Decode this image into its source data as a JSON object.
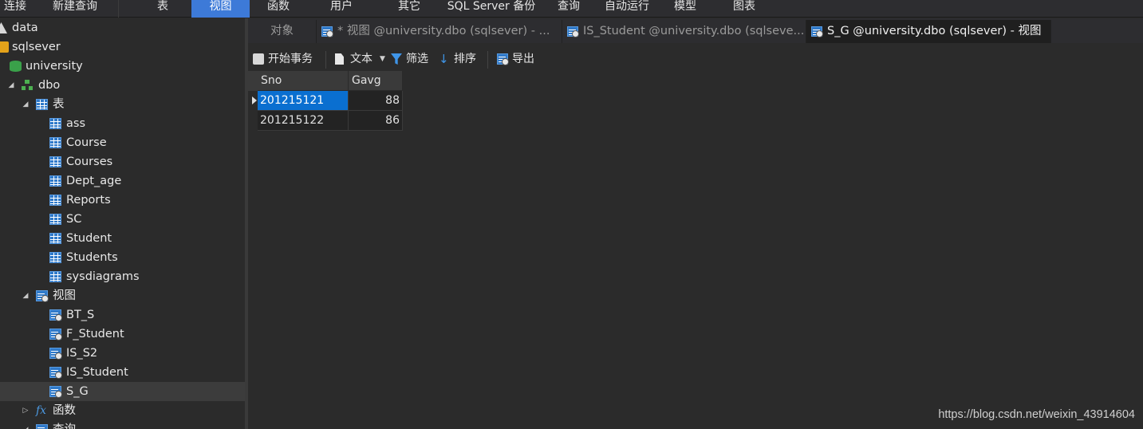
{
  "menu": {
    "items": [
      "连接",
      "新建查询",
      "表",
      "视图",
      "函数",
      "用户",
      "其它",
      "SQL Server 备份",
      "查询",
      "自动运行",
      "模型",
      "图表"
    ],
    "active": "视图"
  },
  "tree": {
    "nodes": [
      {
        "label": "data",
        "icon": "data-icon"
      },
      {
        "label": "sqlsever",
        "icon": "connection-icon"
      },
      {
        "label": "university",
        "icon": "database-icon"
      },
      {
        "label": "dbo",
        "icon": "schema-icon"
      },
      {
        "label": "表",
        "icon": "table-folder-icon"
      },
      {
        "label": "ass",
        "icon": "table-icon"
      },
      {
        "label": "Course",
        "icon": "table-icon"
      },
      {
        "label": "Courses",
        "icon": "table-icon"
      },
      {
        "label": "Dept_age",
        "icon": "table-icon"
      },
      {
        "label": "Reports",
        "icon": "table-icon"
      },
      {
        "label": "SC",
        "icon": "table-icon"
      },
      {
        "label": "Student",
        "icon": "table-icon"
      },
      {
        "label": "Students",
        "icon": "table-icon"
      },
      {
        "label": "sysdiagrams",
        "icon": "table-icon"
      },
      {
        "label": "视图",
        "icon": "view-folder-icon"
      },
      {
        "label": "BT_S",
        "icon": "view-icon"
      },
      {
        "label": "F_Student",
        "icon": "view-icon"
      },
      {
        "label": "IS_S2",
        "icon": "view-icon"
      },
      {
        "label": "IS_Student",
        "icon": "view-icon"
      },
      {
        "label": "S_G",
        "icon": "view-icon",
        "selected": true
      },
      {
        "label": "函数",
        "icon": "function-icon"
      },
      {
        "label": "查询",
        "icon": "query-icon"
      }
    ]
  },
  "tabs": [
    {
      "label": "对象",
      "icon": ""
    },
    {
      "label": "* 视图 @university.dbo (sqlsever) - ...",
      "icon": "view-design-icon"
    },
    {
      "label": "IS_Student @university.dbo (sqlseve...",
      "icon": "view-icon"
    },
    {
      "label": "S_G @university.dbo (sqlsever) - 视图",
      "icon": "view-icon",
      "active": true
    }
  ],
  "toolbar": {
    "begin_transaction": "开始事务",
    "text": "文本",
    "filter": "筛选",
    "sort": "排序",
    "export": "导出"
  },
  "grid": {
    "columns": [
      "Sno",
      "Gavg"
    ],
    "rows": [
      [
        "201215121",
        "88"
      ],
      [
        "201215122",
        "86"
      ]
    ]
  },
  "watermark": "https://blog.csdn.net/weixin_43914604",
  "colors": {
    "accent": "#3d7ad8",
    "selection": "#0a6fd0",
    "background": "#2b2b2b"
  }
}
